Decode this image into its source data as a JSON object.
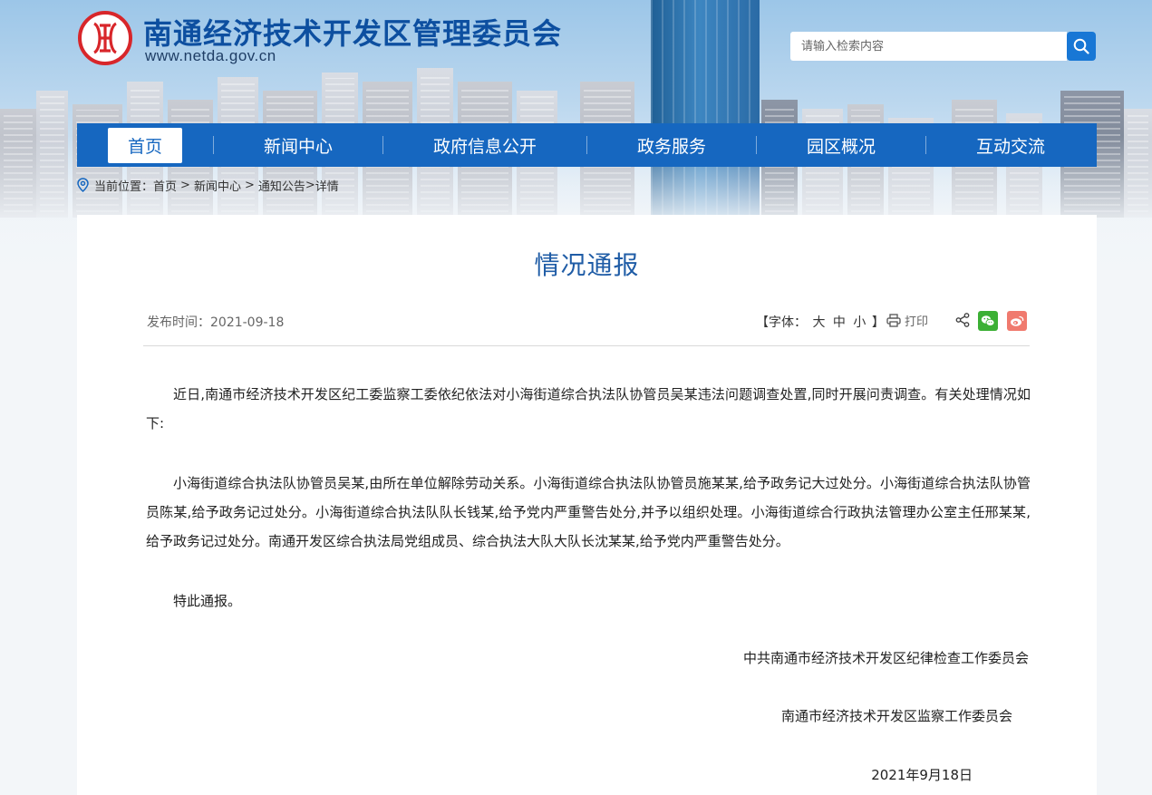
{
  "site": {
    "title": "南通经济技术开发区管理委员会",
    "url": "www.netda.gov.cn"
  },
  "search": {
    "placeholder": "请输入检索内容",
    "icon": "search-icon"
  },
  "nav": {
    "items": [
      {
        "label": "首页",
        "active": true
      },
      {
        "label": "新闻中心"
      },
      {
        "label": "政府信息公开"
      },
      {
        "label": "政务服务"
      },
      {
        "label": "园区概况"
      },
      {
        "label": "互动交流"
      }
    ]
  },
  "breadcrumb": {
    "prefix": "当前位置：",
    "items": [
      "首页",
      "新闻中心",
      "通知公告"
    ],
    "current": "详情"
  },
  "article": {
    "title": "情况通报",
    "publish": "发布时间：2021-09-18",
    "font_label_open": "【字体：",
    "font_sizes": [
      "大",
      "中",
      "小"
    ],
    "font_label_close": "】",
    "print_label": "打印",
    "paragraphs": [
      "近日,南通市经济技术开发区纪工委监察工委依纪依法对小海街道综合执法队协管员吴某违法问题调查处置,同时开展问责调查。有关处理情况如下:",
      "小海街道综合执法队协管员吴某,由所在单位解除劳动关系。小海街道综合执法队协管员施某某,给予政务记大过处分。小海街道综合执法队协管员陈某,给予政务记过处分。小海街道综合执法队队长钱某,给予党内严重警告处分,并予以组织处理。小海街道综合行政执法管理办公室主任邢某某,给予政务记过处分。南通开发区综合执法局党组成员、综合执法大队大队长沈某某,给予党内严重警告处分。",
      "特此通报。"
    ],
    "signature_1": "中共南通市经济技术开发区纪律检查工作委员会",
    "signature_2": "南通市经济技术开发区监察工作委员会",
    "date": "2021年9月18日"
  },
  "colors": {
    "nav": "#1667c0",
    "title": "#1f5ca6",
    "site_title": "#0d4fa0",
    "logo_red": "#d8262a",
    "wechat": "#3cb035",
    "weibo": "#f07a6e"
  }
}
